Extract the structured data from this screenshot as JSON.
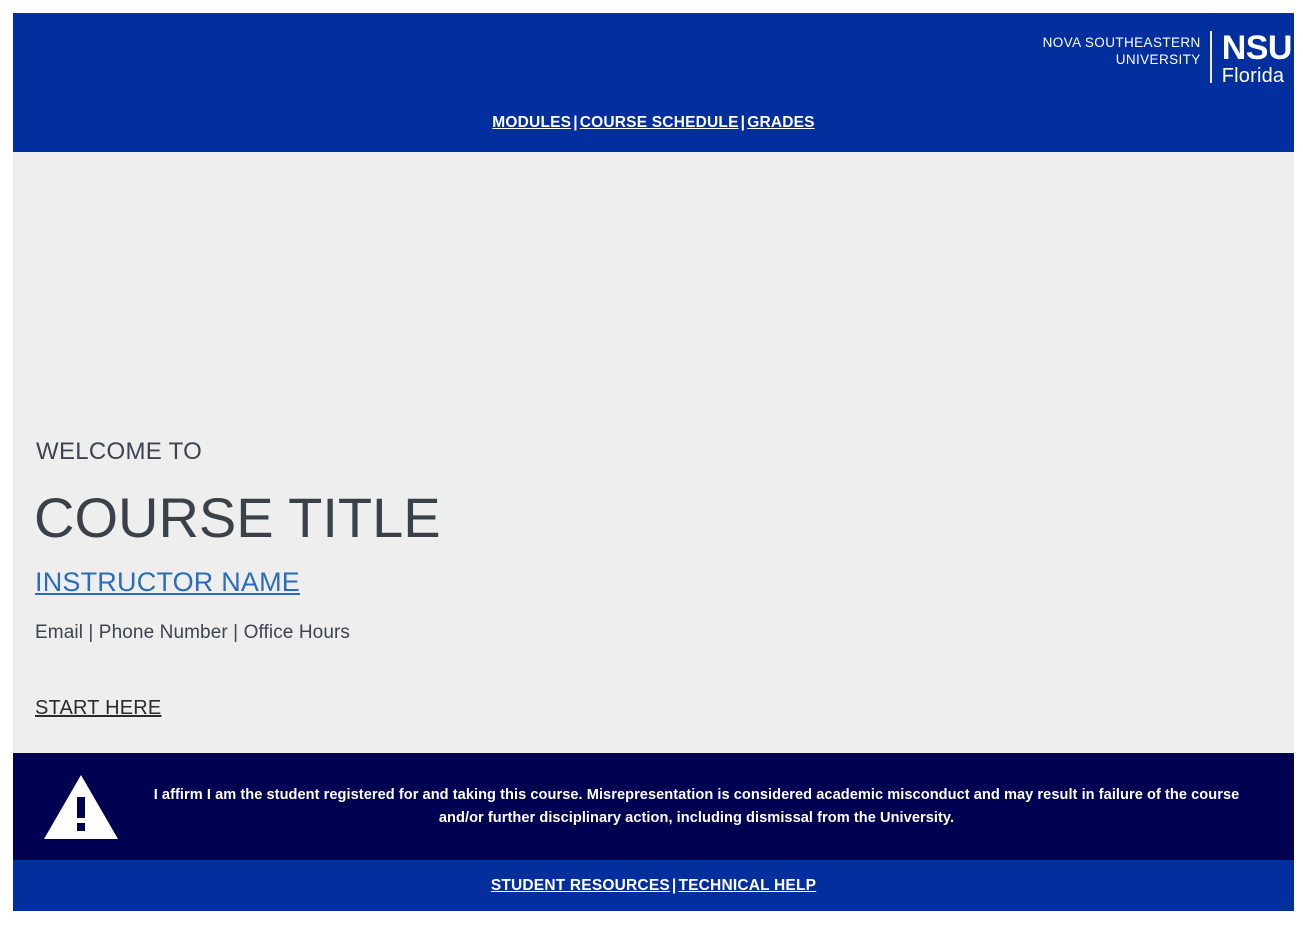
{
  "header": {
    "brand": {
      "university_line1": "NOVA SOUTHEASTERN",
      "university_line2": "UNIVERSITY",
      "mark": "NSU",
      "mark_sub": "Florida"
    },
    "nav": {
      "items": [
        {
          "label": "MODULES"
        },
        {
          "label": "COURSE SCHEDULE"
        },
        {
          "label": "GRADES"
        }
      ],
      "separator": "|"
    }
  },
  "main": {
    "welcome_label": "WELCOME TO",
    "course_title": "COURSE TITLE",
    "instructor_name": "INSTRUCTOR NAME",
    "instructor_meta": "Email | Phone Number | Office Hours",
    "start_here": "START HERE"
  },
  "affirmation": {
    "icon": "warning-triangle-icon",
    "text": "I affirm I am the student registered for and taking this course. Misrepresentation is considered academic misconduct and may result in failure of the course and/or further disciplinary action, including dismissal from the University."
  },
  "footer": {
    "items": [
      {
        "label": "STUDENT RESOURCES"
      },
      {
        "label": "TECHNICAL HELP"
      }
    ],
    "separator": "|"
  },
  "colors": {
    "header_blue": "#032f9e",
    "affirmation_navy": "#000053",
    "page_background": "#eeeeee",
    "link_blue": "#2b6cb8",
    "body_text": "#3d4450"
  }
}
